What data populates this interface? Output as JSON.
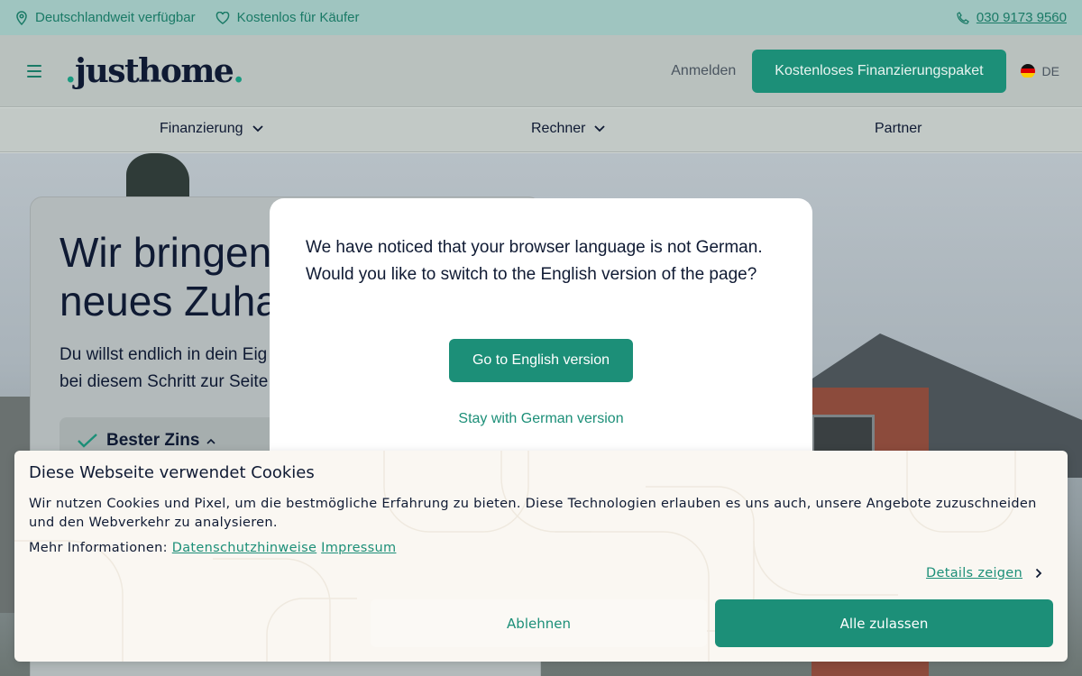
{
  "topbar": {
    "availability": "Deutschlandweit verfügbar",
    "free": "Kostenlos für Käufer",
    "phone": "030 9173 9560"
  },
  "header": {
    "logo": "justhome",
    "login": "Anmelden",
    "cta": "Kostenloses Finanzierungspaket",
    "language": "DE"
  },
  "nav": {
    "items": [
      {
        "label": "Finanzierung"
      },
      {
        "label": "Rechner"
      },
      {
        "label": "Partner"
      }
    ]
  },
  "hero": {
    "heading_line1": "Wir bringen",
    "heading_line2": "neues Zuha",
    "text_line1": "Du willst endlich in dein Eig",
    "text_line2": "bei diesem Schritt zur Seite",
    "badge": "Bester Zins"
  },
  "language_modal": {
    "message_line1": "We have noticed that your browser language is not German.",
    "message_line2": "Would you like to switch to the English version of the page?",
    "go_button": "Go to English version",
    "stay_link": "Stay with German version"
  },
  "cookie_banner": {
    "title": "Diese Webseite verwendet Cookies",
    "description": "Wir nutzen Cookies und Pixel, um die bestmögliche Erfahrung zu bieten. Diese Technologien erlauben es uns auch, unsere Angebote zuzuschneiden und den Webverkehr zu analysieren.",
    "more_label": "Mehr Informationen:",
    "privacy_link": "Datenschutzhinweise",
    "imprint_link": "Impressum",
    "details_link": "Details zeigen",
    "reject_button": "Ablehnen",
    "accept_button": "Alle zulassen"
  },
  "colors": {
    "brand": "#1c8f78",
    "topbar_bg": "#9fc5c0",
    "text_dark": "#0f1a33"
  }
}
